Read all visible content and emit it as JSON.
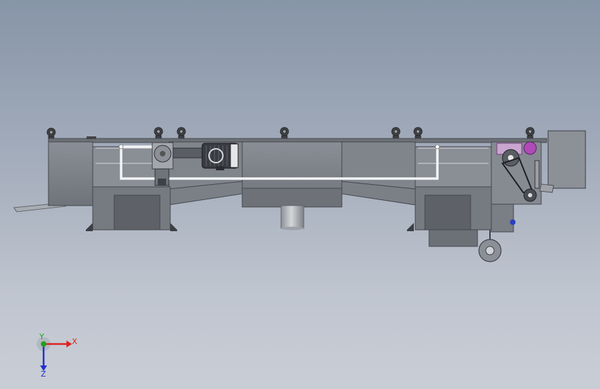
{
  "app": {
    "view": "front"
  },
  "triad": {
    "x_label": "X",
    "y_label": "Y",
    "z_label": "Z",
    "colors": {
      "x": "#e02020",
      "y": "#20a020",
      "z": "#2030d0"
    }
  },
  "colors": {
    "background_top": "#8795a8",
    "background_bottom": "#c9ced6",
    "frame": "#7e838c",
    "frame_dark": "#55595f",
    "frame_light": "#9a9ea5",
    "motor": "#3c3f45",
    "pipe": "#e9ebee",
    "accent_magenta": "#b04ab8",
    "accent_blue": "#2a3fc0",
    "control_box": "#8c9097"
  }
}
